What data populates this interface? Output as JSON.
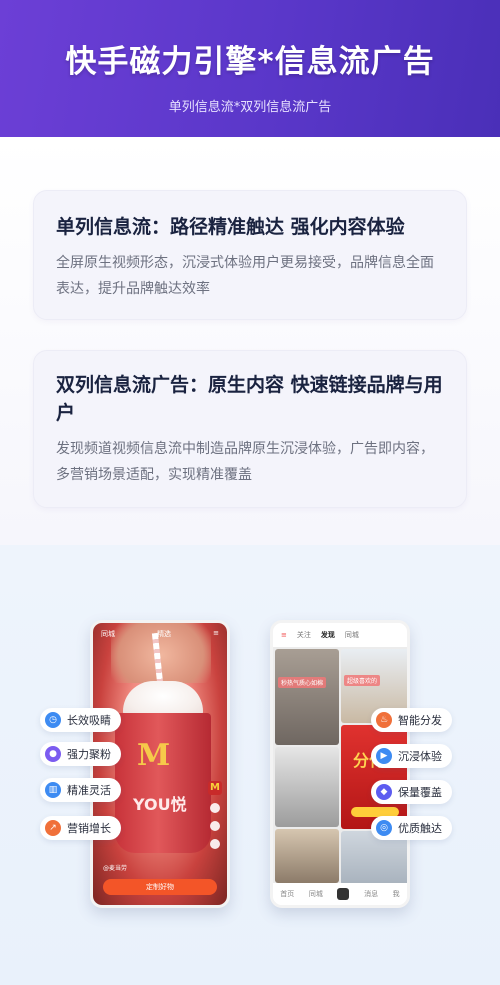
{
  "header": {
    "title": "快手磁力引擎*信息流广告",
    "subtitle": "单列信息流*双列信息流广告"
  },
  "cards": [
    {
      "title": "单列信息流：路径精准触达 强化内容体验",
      "description": "全屏原生视频形态，沉浸式体验用户更易接受，品牌信息全面表达，提升品牌触达效率"
    },
    {
      "title": "双列信息流广告：原生内容 快速链接品牌与用户",
      "description": "发现频道视频信息流中制造品牌原生沉浸体验，广告即内容，多营销场景适配，实现精准覆盖"
    }
  ],
  "left_phone": {
    "top_left": "同城",
    "top_center": "精选",
    "cup_text": "YOU悦",
    "caption": "@麦当劳",
    "cta": "定制好物"
  },
  "right_phone": {
    "tabs": [
      "关注",
      "发现",
      "同城"
    ],
    "active_tab": "发现",
    "tile_labels": [
      "秒热气质心如棉",
      "超级喜欢的"
    ],
    "promo_text": "分什么",
    "nav": [
      "首页",
      "同城",
      "消息",
      "我"
    ]
  },
  "left_tags": [
    {
      "label": "长效吸睛",
      "icon": "clock-icon",
      "color": "blue"
    },
    {
      "label": "强力聚粉",
      "icon": "people-icon",
      "color": "purple"
    },
    {
      "label": "精准灵活",
      "icon": "chart-icon",
      "color": "blue"
    },
    {
      "label": "营销增长",
      "icon": "growth-icon",
      "color": "orange"
    }
  ],
  "right_tags": [
    {
      "label": "智能分发",
      "icon": "flame-icon",
      "color": "orange"
    },
    {
      "label": "沉浸体验",
      "icon": "play-icon",
      "color": "blue"
    },
    {
      "label": "保量覆盖",
      "icon": "shield-icon",
      "color": "indigo"
    },
    {
      "label": "优质触达",
      "icon": "target-icon",
      "color": "blue"
    }
  ]
}
